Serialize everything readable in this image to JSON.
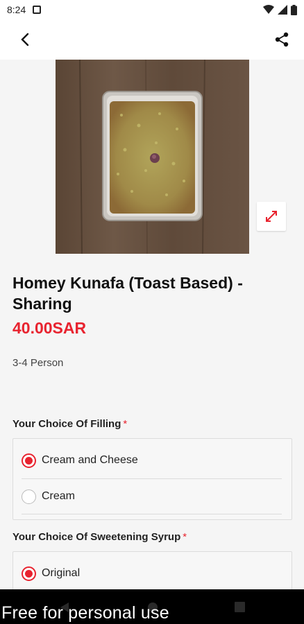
{
  "status_bar": {
    "time": "8:24"
  },
  "product": {
    "title": "Homey Kunafa (Toast Based) - Sharing",
    "price": "40.00SAR",
    "description": "3-4 Person"
  },
  "sections": [
    {
      "label": "Your Choice Of Filling",
      "required_mark": "*",
      "options": [
        {
          "label": "Cream and Cheese",
          "selected": true
        },
        {
          "label": "Cream",
          "selected": false
        }
      ]
    },
    {
      "label": "Your Choice Of Sweetening Syrup",
      "required_mark": "*",
      "options": [
        {
          "label": "Original",
          "selected": true
        }
      ]
    }
  ],
  "watermark": "Free for personal use",
  "colors": {
    "accent": "#e8232f",
    "background": "#f5f5f5",
    "nav_bar": "#000000"
  },
  "icons": [
    "back-arrow-icon",
    "share-icon",
    "expand-icon",
    "wifi-icon",
    "signal-icon",
    "battery-icon",
    "notification-icon"
  ]
}
